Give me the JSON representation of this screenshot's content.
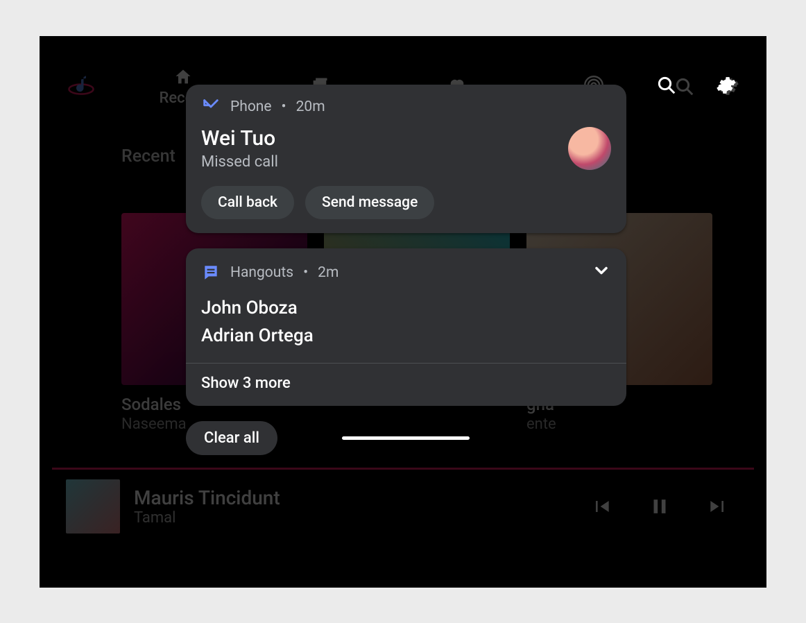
{
  "app": {
    "tabs": [
      {
        "label": "Recent",
        "icon": "home"
      },
      {
        "label": "",
        "icon": "library"
      },
      {
        "label": "",
        "icon": "heart"
      },
      {
        "label": "",
        "icon": "radio"
      }
    ],
    "section_title": "Recent",
    "cards": [
      {
        "title": "Sodales",
        "artist": "Naseema"
      },
      {
        "title": "",
        "artist": ""
      },
      {
        "title": "gna",
        "artist": "ente"
      }
    ],
    "now_playing": {
      "title": "Mauris Tincidunt",
      "artist": "Tamal"
    }
  },
  "shade": {
    "notifications": [
      {
        "app": "Phone",
        "time": "20m",
        "title": "Wei Tuo",
        "subtitle": "Missed call",
        "actions": [
          "Call back",
          "Send message"
        ]
      },
      {
        "app": "Hangouts",
        "time": "2m",
        "names": [
          "John Oboza",
          "Adrian Ortega"
        ],
        "show_more_label": "Show 3 more"
      }
    ],
    "clear_all_label": "Clear all"
  }
}
